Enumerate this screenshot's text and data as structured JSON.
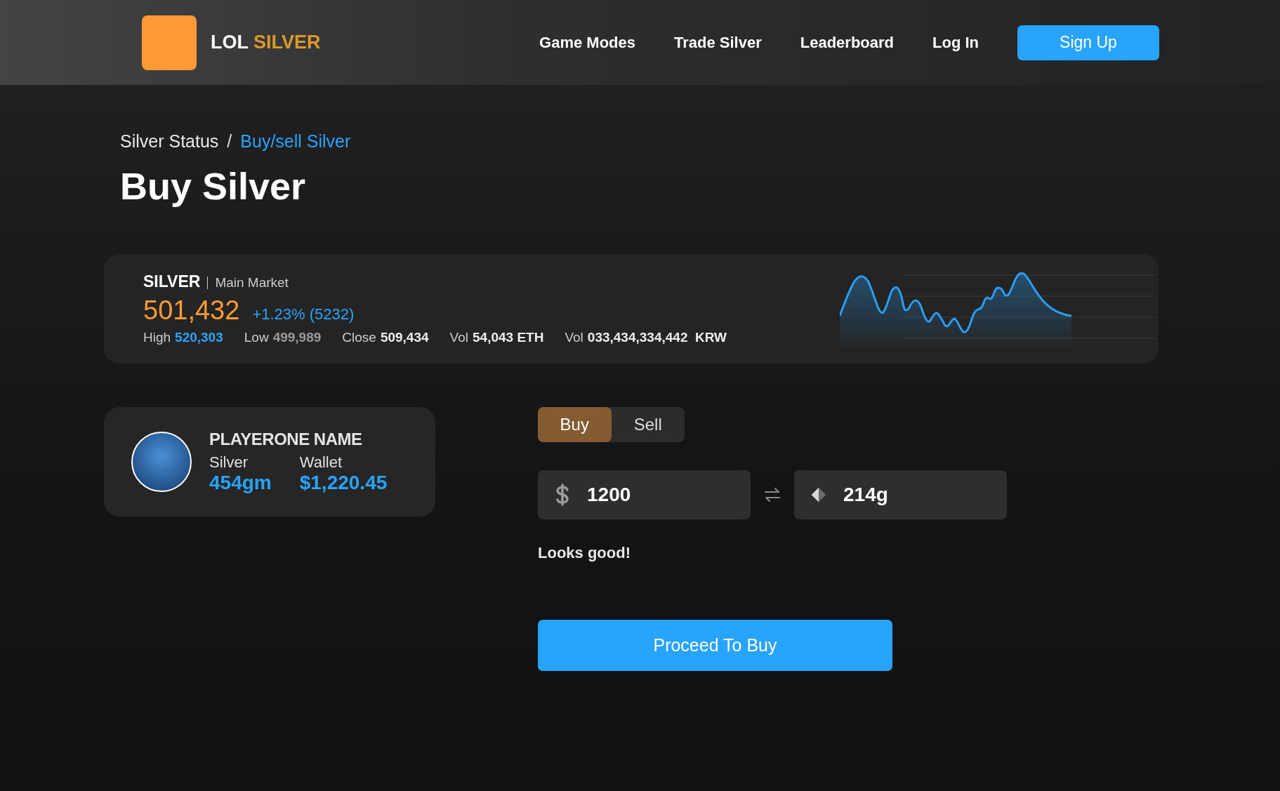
{
  "header": {
    "logo": {
      "brand": "LOL",
      "accent": "SILVER"
    },
    "nav": [
      {
        "label": "Game Modes"
      },
      {
        "label": "Trade Silver"
      },
      {
        "label": "Leaderboard"
      },
      {
        "label": "Log In"
      }
    ],
    "signup": "Sign Up"
  },
  "breadcrumb": [
    {
      "label": "Silver Status",
      "current": false
    },
    {
      "label": "Buy/sell Silver",
      "current": true
    }
  ],
  "breadcrumb_separator": "/",
  "title": "Buy Silver",
  "market": {
    "symbol": "SILVER",
    "market": "Main Market",
    "price": "501,432",
    "change": "+1.23% (5232)",
    "stats": [
      {
        "label": "High",
        "value": "520,303",
        "color": "#28a4ff"
      },
      {
        "label": "Low",
        "value": "499,989",
        "color": "#9a9a9a"
      },
      {
        "label": "Close",
        "value": "509,434",
        "color": "#eeeeee"
      },
      {
        "label": "Vol",
        "value": "54,043 ETH",
        "color": "#eeeeee"
      },
      {
        "label": "Vol",
        "value": "033,434,334,442  KRW",
        "color": "#eeeeee"
      }
    ]
  },
  "player": {
    "name": "PLAYERONE NAME",
    "balances": [
      {
        "label": "Silver",
        "value": "454gm"
      },
      {
        "label": "Wallet",
        "value": "$1,220.45"
      }
    ]
  },
  "trade": {
    "tabs": [
      {
        "label": "Buy",
        "selected": true
      },
      {
        "label": "Sell",
        "selected": false
      }
    ],
    "fields": [
      {
        "kind": "currency",
        "value": "1200"
      },
      {
        "kind": "silver",
        "value": "214g"
      }
    ],
    "message": "Looks good!",
    "submit": "Proceed To Buy"
  }
}
